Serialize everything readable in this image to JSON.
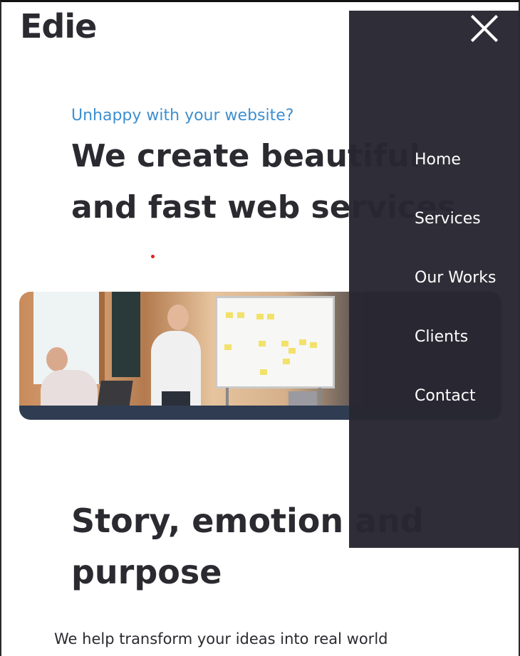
{
  "brand": {
    "logo_text": "Edie"
  },
  "hero": {
    "kicker": "Unhappy with your website?",
    "title_line1": "We create beautiful",
    "title_line2": "and fast web services"
  },
  "story": {
    "title_line1": "Story, emotion and",
    "title_line2": "purpose",
    "text": "We help transform your ideas into real world"
  },
  "menu": {
    "close_icon": "close-icon",
    "items": [
      {
        "label": "Home"
      },
      {
        "label": "Services"
      },
      {
        "label": "Our Works"
      },
      {
        "label": "Clients"
      },
      {
        "label": "Contact"
      }
    ]
  },
  "colors": {
    "accent": "#3d8fd0",
    "text": "#2b2a30",
    "menu_bg": "#282732",
    "menu_text": "#ffffff"
  }
}
